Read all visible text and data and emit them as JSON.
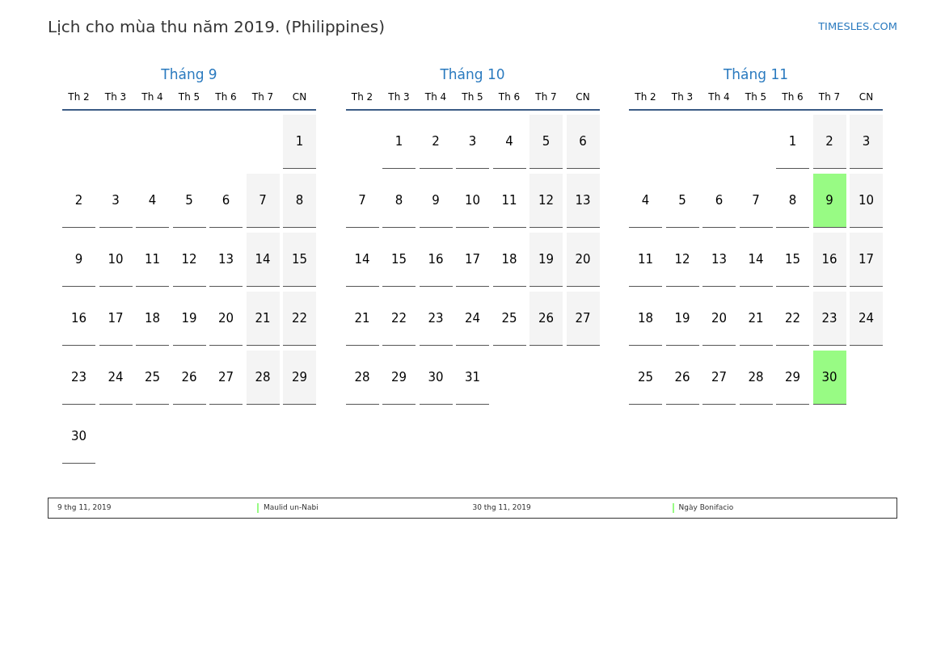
{
  "title": "Lịch cho mùa thu năm 2019. (Philippines)",
  "site": "TIMESLES.COM",
  "months": [
    {
      "name": "Tháng 9",
      "weekdays": [
        "Th 2",
        "Th 3",
        "Th 4",
        "Th 5",
        "Th 6",
        "Th 7",
        "CN"
      ],
      "weeks": [
        [
          {
            "kind": "blank"
          },
          {
            "kind": "blank"
          },
          {
            "kind": "blank"
          },
          {
            "kind": "blank"
          },
          {
            "kind": "blank"
          },
          {
            "kind": "blank"
          },
          {
            "day": "1",
            "kind": "weekend"
          }
        ],
        [
          {
            "day": "2",
            "kind": "day"
          },
          {
            "day": "3",
            "kind": "day"
          },
          {
            "day": "4",
            "kind": "day"
          },
          {
            "day": "5",
            "kind": "day"
          },
          {
            "day": "6",
            "kind": "day"
          },
          {
            "day": "7",
            "kind": "weekend"
          },
          {
            "day": "8",
            "kind": "weekend"
          }
        ],
        [
          {
            "day": "9",
            "kind": "day"
          },
          {
            "day": "10",
            "kind": "day"
          },
          {
            "day": "11",
            "kind": "day"
          },
          {
            "day": "12",
            "kind": "day"
          },
          {
            "day": "13",
            "kind": "day"
          },
          {
            "day": "14",
            "kind": "weekend"
          },
          {
            "day": "15",
            "kind": "weekend"
          }
        ],
        [
          {
            "day": "16",
            "kind": "day"
          },
          {
            "day": "17",
            "kind": "day"
          },
          {
            "day": "18",
            "kind": "day"
          },
          {
            "day": "19",
            "kind": "day"
          },
          {
            "day": "20",
            "kind": "day"
          },
          {
            "day": "21",
            "kind": "weekend"
          },
          {
            "day": "22",
            "kind": "weekend"
          }
        ],
        [
          {
            "day": "23",
            "kind": "day"
          },
          {
            "day": "24",
            "kind": "day"
          },
          {
            "day": "25",
            "kind": "day"
          },
          {
            "day": "26",
            "kind": "day"
          },
          {
            "day": "27",
            "kind": "day"
          },
          {
            "day": "28",
            "kind": "weekend"
          },
          {
            "day": "29",
            "kind": "weekend"
          }
        ],
        [
          {
            "day": "30",
            "kind": "day"
          }
        ]
      ]
    },
    {
      "name": "Tháng 10",
      "weekdays": [
        "Th 2",
        "Th 3",
        "Th 4",
        "Th 5",
        "Th 6",
        "Th 7",
        "CN"
      ],
      "weeks": [
        [
          {
            "kind": "blank"
          },
          {
            "day": "1",
            "kind": "day"
          },
          {
            "day": "2",
            "kind": "day"
          },
          {
            "day": "3",
            "kind": "day"
          },
          {
            "day": "4",
            "kind": "day"
          },
          {
            "day": "5",
            "kind": "weekend"
          },
          {
            "day": "6",
            "kind": "weekend"
          }
        ],
        [
          {
            "day": "7",
            "kind": "day"
          },
          {
            "day": "8",
            "kind": "day"
          },
          {
            "day": "9",
            "kind": "day"
          },
          {
            "day": "10",
            "kind": "day"
          },
          {
            "day": "11",
            "kind": "day"
          },
          {
            "day": "12",
            "kind": "weekend"
          },
          {
            "day": "13",
            "kind": "weekend"
          }
        ],
        [
          {
            "day": "14",
            "kind": "day"
          },
          {
            "day": "15",
            "kind": "day"
          },
          {
            "day": "16",
            "kind": "day"
          },
          {
            "day": "17",
            "kind": "day"
          },
          {
            "day": "18",
            "kind": "day"
          },
          {
            "day": "19",
            "kind": "weekend"
          },
          {
            "day": "20",
            "kind": "weekend"
          }
        ],
        [
          {
            "day": "21",
            "kind": "day"
          },
          {
            "day": "22",
            "kind": "day"
          },
          {
            "day": "23",
            "kind": "day"
          },
          {
            "day": "24",
            "kind": "day"
          },
          {
            "day": "25",
            "kind": "day"
          },
          {
            "day": "26",
            "kind": "weekend"
          },
          {
            "day": "27",
            "kind": "weekend"
          }
        ],
        [
          {
            "day": "28",
            "kind": "day"
          },
          {
            "day": "29",
            "kind": "day"
          },
          {
            "day": "30",
            "kind": "day"
          },
          {
            "day": "31",
            "kind": "day"
          }
        ]
      ]
    },
    {
      "name": "Tháng 11",
      "weekdays": [
        "Th 2",
        "Th 3",
        "Th 4",
        "Th 5",
        "Th 6",
        "Th 7",
        "CN"
      ],
      "weeks": [
        [
          {
            "kind": "blank"
          },
          {
            "kind": "blank"
          },
          {
            "kind": "blank"
          },
          {
            "kind": "blank"
          },
          {
            "day": "1",
            "kind": "day"
          },
          {
            "day": "2",
            "kind": "weekend"
          },
          {
            "day": "3",
            "kind": "weekend"
          }
        ],
        [
          {
            "day": "4",
            "kind": "day"
          },
          {
            "day": "5",
            "kind": "day"
          },
          {
            "day": "6",
            "kind": "day"
          },
          {
            "day": "7",
            "kind": "day"
          },
          {
            "day": "8",
            "kind": "day"
          },
          {
            "day": "9",
            "kind": "holiday"
          },
          {
            "day": "10",
            "kind": "weekend"
          }
        ],
        [
          {
            "day": "11",
            "kind": "day"
          },
          {
            "day": "12",
            "kind": "day"
          },
          {
            "day": "13",
            "kind": "day"
          },
          {
            "day": "14",
            "kind": "day"
          },
          {
            "day": "15",
            "kind": "day"
          },
          {
            "day": "16",
            "kind": "weekend"
          },
          {
            "day": "17",
            "kind": "weekend"
          }
        ],
        [
          {
            "day": "18",
            "kind": "day"
          },
          {
            "day": "19",
            "kind": "day"
          },
          {
            "day": "20",
            "kind": "day"
          },
          {
            "day": "21",
            "kind": "day"
          },
          {
            "day": "22",
            "kind": "day"
          },
          {
            "day": "23",
            "kind": "weekend"
          },
          {
            "day": "24",
            "kind": "weekend"
          }
        ],
        [
          {
            "day": "25",
            "kind": "day"
          },
          {
            "day": "26",
            "kind": "day"
          },
          {
            "day": "27",
            "kind": "day"
          },
          {
            "day": "28",
            "kind": "day"
          },
          {
            "day": "29",
            "kind": "day"
          },
          {
            "day": "30",
            "kind": "holiday"
          }
        ]
      ]
    }
  ],
  "legend": [
    {
      "date": "9 thg 11, 2019",
      "name": "Maulid un-Nabi",
      "color": "#98fb84"
    },
    {
      "date": "30 thg 11, 2019",
      "name": "Ngày Bonifacio",
      "color": "#98fb84"
    }
  ]
}
